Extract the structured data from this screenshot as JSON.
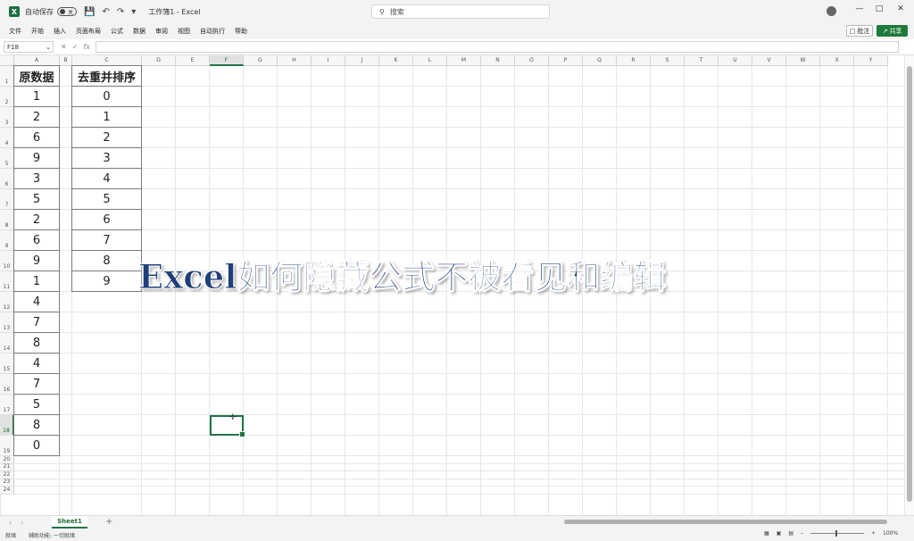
{
  "titlebar": {
    "autosave_label": "自动保存",
    "autosave_state": "关",
    "document_title": "工作簿1 - Excel",
    "search_placeholder": "搜索"
  },
  "menu": {
    "items": [
      "文件",
      "开始",
      "插入",
      "页面布局",
      "公式",
      "数据",
      "审阅",
      "视图",
      "自动执行",
      "帮助"
    ],
    "comment_label": "批注",
    "share_label": "共享"
  },
  "formula_bar": {
    "name_box": "F18",
    "fx_label": "fx",
    "formula": ""
  },
  "grid": {
    "columns": [
      "A",
      "B",
      "C",
      "D",
      "E",
      "F",
      "G",
      "H",
      "I",
      "J",
      "K",
      "L",
      "M",
      "N",
      "O",
      "P",
      "Q",
      "R",
      "S",
      "T",
      "U",
      "V",
      "W",
      "X",
      "Y"
    ],
    "selected_column": "F",
    "selected_row": "18",
    "rows": [
      "1",
      "2",
      "3",
      "4",
      "5",
      "6",
      "7",
      "8",
      "9",
      "10",
      "11",
      "12",
      "13",
      "14",
      "15",
      "16",
      "17",
      "18",
      "19",
      "20",
      "21",
      "22",
      "23",
      "24"
    ]
  },
  "data": {
    "colA_header": "原数据",
    "colA_values": [
      "1",
      "2",
      "6",
      "9",
      "3",
      "5",
      "2",
      "6",
      "9",
      "1",
      "4",
      "7",
      "8",
      "4",
      "7",
      "5",
      "8",
      "0"
    ],
    "colC_header": "去重并排序",
    "colC_values": [
      "0",
      "1",
      "2",
      "3",
      "4",
      "5",
      "6",
      "7",
      "8",
      "9"
    ]
  },
  "overlay": {
    "caption": "Excel如何隐藏公式不被看见和编辑"
  },
  "sheets": {
    "tabs": [
      "Sheet1"
    ],
    "add_label": "+"
  },
  "status": {
    "ready": "就绪",
    "accessibility": "辅助功能: 一切就绪",
    "zoom": "100%"
  },
  "colors": {
    "excel_green": "#217346",
    "overlay_text": "#1f3f7a"
  }
}
